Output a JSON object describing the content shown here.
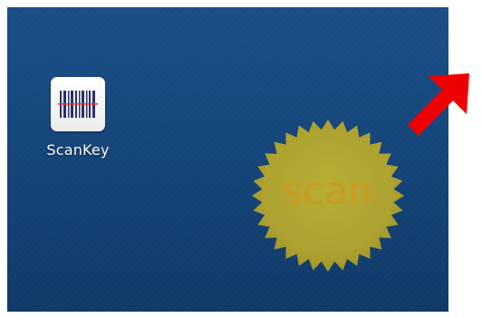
{
  "home_screen": {
    "app": {
      "label": "ScanKey",
      "icon": "barcode-scanner-icon"
    },
    "scan_badge": {
      "text": "scan",
      "color": "#b3a82e"
    },
    "pointer_arrow": {
      "icon": "red-arrow-icon",
      "color": "#ee0000"
    },
    "wallpaper_color": "#15467b"
  }
}
